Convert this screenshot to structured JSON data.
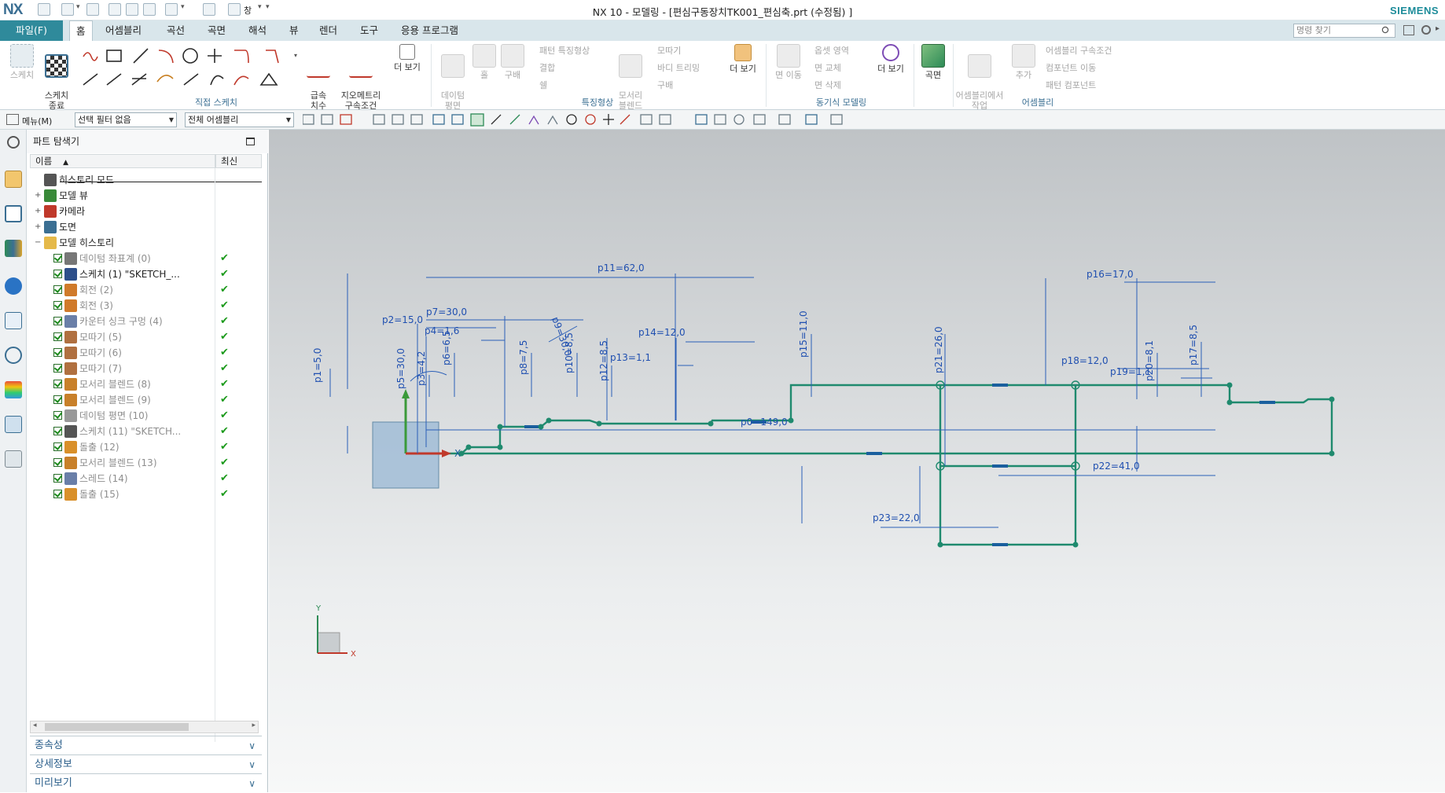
{
  "window": {
    "logo": "NX",
    "title": "NX 10 - 모델링 - [편심구동장치TK001_편심축.prt (수정됨) ]",
    "brand": "SIEMENS",
    "quick_access_window": "창"
  },
  "menu": {
    "file": "파일(F)",
    "tabs": [
      "홈",
      "어셈블리",
      "곡선",
      "곡면",
      "해석",
      "뷰",
      "렌더",
      "도구",
      "응용 프로그램"
    ],
    "search_placeholder": "명령 찾기"
  },
  "ribbon": {
    "sketch": "스케치",
    "finish_sketch": "스케치\n종료",
    "rapid_dim": "급속\n치수",
    "geo_constraint": "지오메트리\n구속조건",
    "more": "더 보기",
    "direct_sketch_group": "직접 스케치",
    "datum": "데이텀\n평면",
    "hole": "홀",
    "pattern": "패턴 특징형상",
    "union": "결합",
    "shell": "쉘",
    "edge_blend": "모서리\n블렌드",
    "chamfer": "모따기",
    "draft": "바디 트리밍",
    "extrude": "구배",
    "feature_group": "특징형상",
    "more2": "더 보기",
    "move_face": "면 이동",
    "offset_region": "옵셋 영역",
    "replace_face": "면 교체",
    "delete_face": "면 삭제",
    "more3": "더 보기",
    "sync_group": "동기식 모델링",
    "surface": "곡면",
    "assembly_constraint": "어셈블리 구속조건",
    "move_component": "컴포넌트 이동",
    "pattern_component": "패턴 컴포넌트",
    "work_in_asm": "어셈블리에서\n작업",
    "add": "추가",
    "asm_group": "어셈블리"
  },
  "selection_bar": {
    "menu": "메뉴(M)",
    "filter": "선택 필터 없음",
    "scope": "전체 어셈블리"
  },
  "navigator": {
    "title": "파트 탐색기",
    "col_name": "이름",
    "col_latest": "최신",
    "tree": [
      {
        "text": "히스토리 모드",
        "level": 0,
        "grey": false,
        "checked": false,
        "latest": false,
        "color": "#555"
      },
      {
        "text": "모델 뷰",
        "level": 0,
        "grey": false,
        "checked": false,
        "latest": false,
        "color": "#3a8a3a"
      },
      {
        "text": "카메라",
        "level": 0,
        "grey": false,
        "checked": false,
        "latest": false,
        "color": "#c0392b"
      },
      {
        "text": "도면",
        "level": 0,
        "grey": false,
        "checked": false,
        "latest": false,
        "color": "#3b6f93"
      },
      {
        "text": "모델 히스토리",
        "level": 0,
        "grey": false,
        "checked": false,
        "latest": false,
        "color": "#e5b94a"
      },
      {
        "text": "데이텀 좌표계 (0)",
        "level": 1,
        "grey": true,
        "checked": true,
        "latest": true,
        "color": "#777"
      },
      {
        "text": "스케치 (1) \"SKETCH_...",
        "level": 1,
        "grey": false,
        "checked": true,
        "latest": true,
        "color": "#2d4f8a"
      },
      {
        "text": "회전 (2)",
        "level": 1,
        "grey": true,
        "checked": true,
        "latest": true,
        "color": "#d07a2a"
      },
      {
        "text": "회전 (3)",
        "level": 1,
        "grey": true,
        "checked": true,
        "latest": true,
        "color": "#d07a2a"
      },
      {
        "text": "카운터 싱크 구멍 (4)",
        "level": 1,
        "grey": true,
        "checked": true,
        "latest": true,
        "color": "#6a7fa8"
      },
      {
        "text": "모따기 (5)",
        "level": 1,
        "grey": true,
        "checked": true,
        "latest": true,
        "color": "#b07040"
      },
      {
        "text": "모따기 (6)",
        "level": 1,
        "grey": true,
        "checked": true,
        "latest": true,
        "color": "#b07040"
      },
      {
        "text": "모따기 (7)",
        "level": 1,
        "grey": true,
        "checked": true,
        "latest": true,
        "color": "#b07040"
      },
      {
        "text": "모서리 블렌드 (8)",
        "level": 1,
        "grey": true,
        "checked": true,
        "latest": true,
        "color": "#c8802a"
      },
      {
        "text": "모서리 블렌드 (9)",
        "level": 1,
        "grey": true,
        "checked": true,
        "latest": true,
        "color": "#c8802a"
      },
      {
        "text": "데이텀 평면 (10)",
        "level": 1,
        "grey": true,
        "checked": true,
        "latest": true,
        "color": "#999"
      },
      {
        "text": "스케치 (11) \"SKETCH...",
        "level": 1,
        "grey": true,
        "checked": true,
        "latest": true,
        "color": "#555"
      },
      {
        "text": "돌출 (12)",
        "level": 1,
        "grey": true,
        "checked": true,
        "latest": true,
        "color": "#d9902a"
      },
      {
        "text": "모서리 블렌드 (13)",
        "level": 1,
        "grey": true,
        "checked": true,
        "latest": true,
        "color": "#c8802a"
      },
      {
        "text": "스레드 (14)",
        "level": 1,
        "grey": true,
        "checked": true,
        "latest": true,
        "color": "#6a7fa8"
      },
      {
        "text": "돌출 (15)",
        "level": 1,
        "grey": true,
        "checked": true,
        "latest": true,
        "color": "#d9902a"
      }
    ],
    "panels": [
      "종속성",
      "상세정보",
      "미리보기"
    ]
  },
  "sketch": {
    "dims": [
      {
        "name": "p0",
        "value": "149,0"
      },
      {
        "name": "p1",
        "value": "5,0"
      },
      {
        "name": "p2",
        "value": "15,0"
      },
      {
        "name": "p3",
        "value": "4,2"
      },
      {
        "name": "p4",
        "value": "1,6"
      },
      {
        "name": "p5",
        "value": "30,0"
      },
      {
        "name": "p6",
        "value": "6,5"
      },
      {
        "name": "p7",
        "value": "30,0"
      },
      {
        "name": "p8",
        "value": "7,5"
      },
      {
        "name": "p9",
        "value": "30,0"
      },
      {
        "name": "p10",
        "value": "8,5"
      },
      {
        "name": "p11",
        "value": "62,0"
      },
      {
        "name": "p12",
        "value": "8,5"
      },
      {
        "name": "p13",
        "value": "1,1"
      },
      {
        "name": "p14",
        "value": "12,0"
      },
      {
        "name": "p15",
        "value": "11,0"
      },
      {
        "name": "p16",
        "value": "17,0"
      },
      {
        "name": "p17",
        "value": "8,5"
      },
      {
        "name": "p18",
        "value": "12,0"
      },
      {
        "name": "p19",
        "value": "1,1"
      },
      {
        "name": "p20",
        "value": "8,1"
      },
      {
        "name": "p21",
        "value": "26,0"
      },
      {
        "name": "p22",
        "value": "41,0"
      },
      {
        "name": "p23",
        "value": "22,0"
      }
    ],
    "triad": {
      "x": "X",
      "y": "Y"
    },
    "view_triad": {
      "x": "X",
      "y": "Y"
    }
  }
}
